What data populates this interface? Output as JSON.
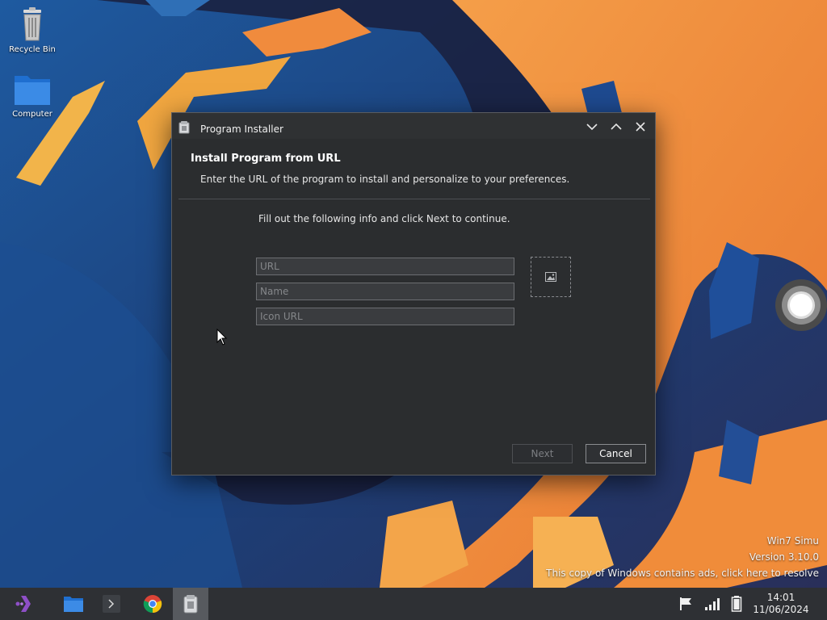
{
  "desktop": {
    "icons": [
      {
        "label": "Recycle Bin",
        "icon": "recycle-bin-icon"
      },
      {
        "label": "Computer",
        "icon": "folder-icon"
      }
    ],
    "watermark": {
      "line1": "Win7 Simu",
      "line2": "Version 3.10.0",
      "line3": "This copy of Windows contains ads, click here to resolve"
    }
  },
  "dialog": {
    "title": "Program Installer",
    "heading": "Install Program from URL",
    "subheading": "Enter the URL of the program to install and personalize to your preferences.",
    "instructions": "Fill out the following info and click Next to continue.",
    "fields": {
      "url": {
        "value": "",
        "placeholder": "URL"
      },
      "name": {
        "value": "",
        "placeholder": "Name"
      },
      "icon_url": {
        "value": "",
        "placeholder": "Icon URL"
      }
    },
    "buttons": {
      "next": "Next",
      "cancel": "Cancel"
    },
    "next_enabled": false
  },
  "taskbar": {
    "items": [
      "start-icon",
      "file-explorer-icon",
      "terminal-icon",
      "chrome-icon",
      "program-installer-icon"
    ],
    "active_item": "program-installer-icon",
    "clock": {
      "time": "14:01",
      "date": "11/06/2024"
    }
  },
  "colors": {
    "dialog_bg": "#2b2d2f",
    "field_bg": "#3a3c3f",
    "taskbar_bg": "#2e3034",
    "accent_orange": "#f2913f",
    "accent_blue": "#1f5fa8"
  }
}
